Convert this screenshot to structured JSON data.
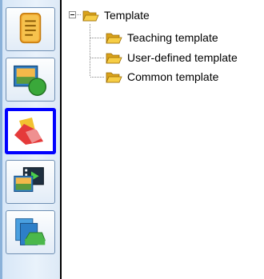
{
  "toolbar": {
    "buttons": [
      {
        "icon": "notes-icon",
        "active": false
      },
      {
        "icon": "picture-shape-icon",
        "active": false
      },
      {
        "icon": "shapes-icon",
        "active": true
      },
      {
        "icon": "video-icon",
        "active": false
      },
      {
        "icon": "copy-image-icon",
        "active": false
      }
    ]
  },
  "tree": {
    "root": {
      "label": "Template",
      "expanded": true
    },
    "children": [
      {
        "label": "Teaching template"
      },
      {
        "label": "User-defined template"
      },
      {
        "label": "Common template"
      }
    ]
  },
  "colors": {
    "active_border": "#0000ff",
    "folder": "#f2c230",
    "toolbar_bg": "#e4eef9"
  }
}
